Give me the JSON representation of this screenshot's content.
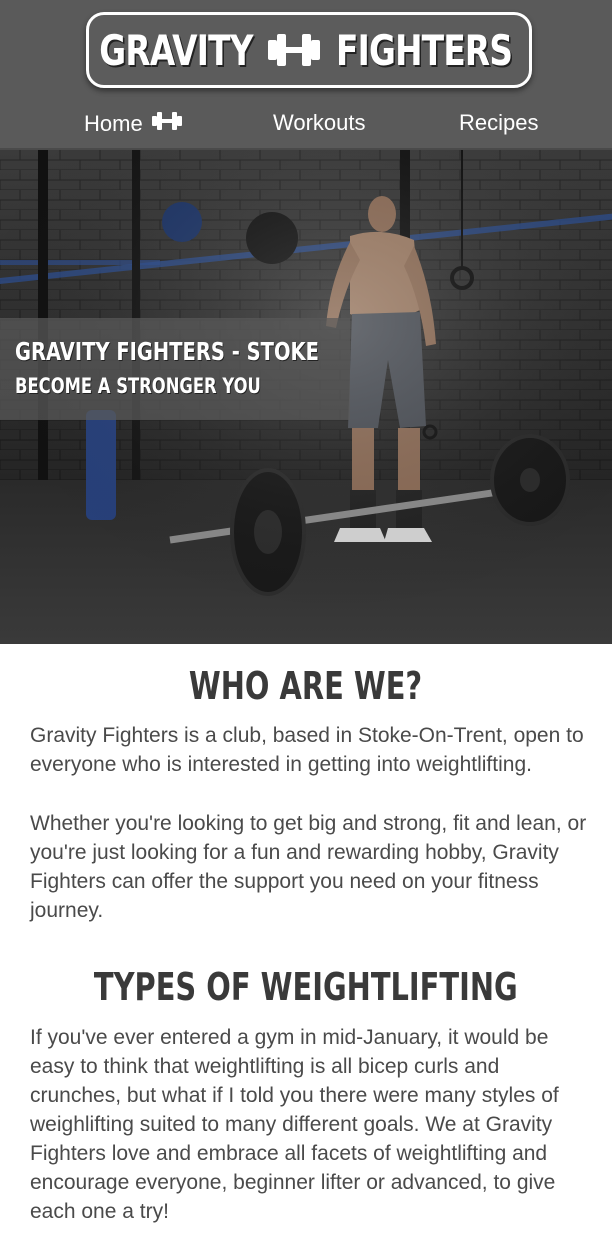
{
  "brand": {
    "left_word": "GRAVITY",
    "right_word": "FIGHTERS"
  },
  "nav": {
    "home": "Home",
    "workouts": "Workouts",
    "recipes": "Recipes"
  },
  "hero": {
    "title": "GRAVITY FIGHTERS - STOKE",
    "subtitle": "BECOME A STRONGER YOU"
  },
  "about": {
    "heading": "WHO ARE WE?",
    "paragraph1": "Gravity Fighters is a club, based in Stoke-On-Trent, open to everyone who is interested in getting into weightlifting.",
    "paragraph2": "Whether you're looking to get big and strong, fit and lean, or you're just looking for a fun and rewarding hobby, Gravity Fighters can offer the support you need on your fitness journey."
  },
  "types": {
    "heading": "TYPES OF WEIGHTLIFTING",
    "paragraph": "If you've ever entered a gym in mid-January, it would be easy to think that weightlifting is all bicep curls and crunches, but what if I told you there were many styles of weighlifting suited to many different goals. We at Gravity Fighters love and embrace all facets of weightlifting and encourage everyone, beginner lifter or advanced, to give each one a try!"
  },
  "colors": {
    "header_bg": "#5a5a5a",
    "heading_text": "#3a3a3a",
    "body_text": "#4a4a4a"
  },
  "icons": {
    "brand_icon": "dumbbell-icon",
    "nav_icon": "dumbbell-icon"
  }
}
